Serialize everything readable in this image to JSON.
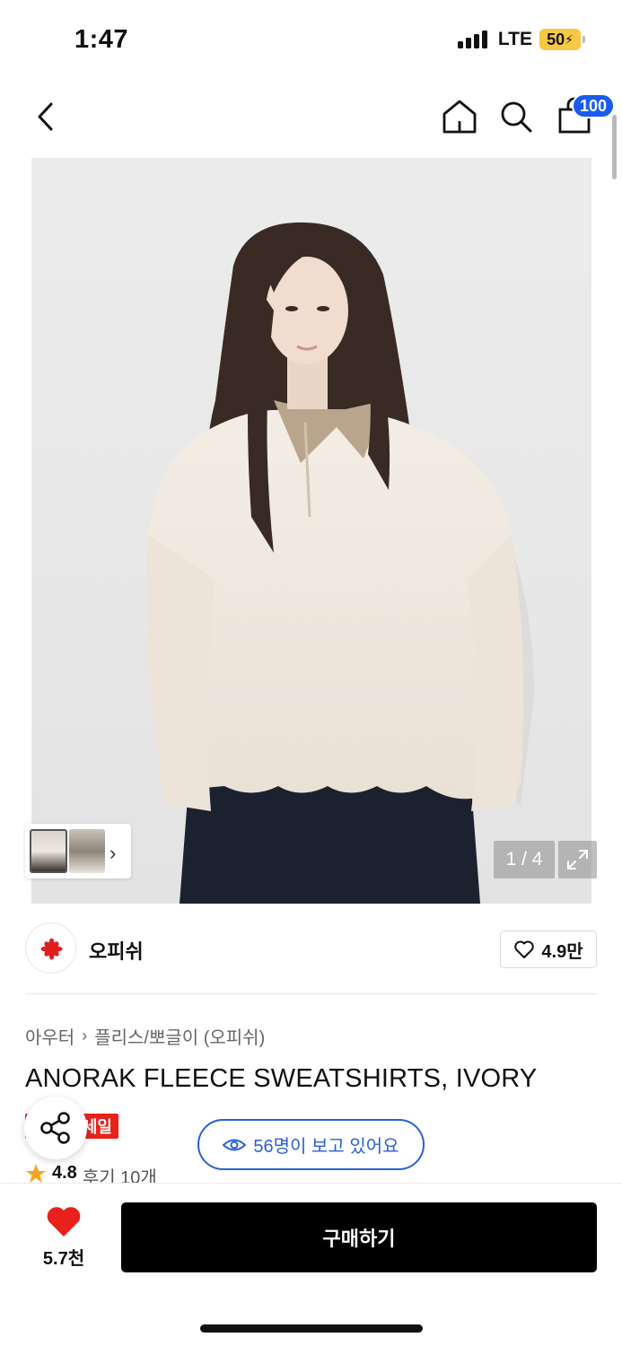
{
  "status_bar": {
    "time": "1:47",
    "network": "LTE",
    "battery": "50"
  },
  "nav": {
    "back_icon": "chevron-left-icon",
    "home_icon": "home-icon",
    "search_icon": "search-icon",
    "bag_icon": "shopping-bag-icon",
    "bag_badge": "100"
  },
  "gallery": {
    "counter": "1 / 4",
    "current_page": 1,
    "total_pages": 4,
    "expand_icon": "expand-icon"
  },
  "brand": {
    "name": "오피쉬",
    "likes": "4.9만",
    "like_icon": "heart-outline-icon"
  },
  "breadcrumb": {
    "category": "아우터",
    "subcategory": "플리스/뽀글이 (오피쉬)"
  },
  "product": {
    "title": "ANORAK FLEECE SWEATSHIRTS, IVORY",
    "sale_badge": "세일",
    "rating": "4.8",
    "reviews": "후기 10개",
    "viewers": "56명이 보고 있어요"
  },
  "bottom": {
    "wish_count": "5.7천",
    "buy_label": "구매하기"
  },
  "colors": {
    "accent_blue": "#1a5cf0",
    "sale_red": "#e8221b",
    "heart_red": "#e8221b",
    "star_orange": "#f5a623"
  }
}
